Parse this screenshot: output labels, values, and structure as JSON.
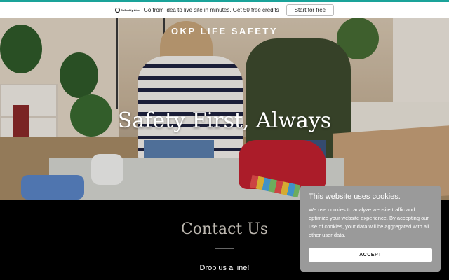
{
  "promo": {
    "brand": "GoDaddy Airo",
    "text": "Go from idea to live site in minutes. Get 50 free credits",
    "button": "Start for free"
  },
  "hero": {
    "site_title": "OKP LIFE SAFETY",
    "heading": "Safety First, Always"
  },
  "contact": {
    "title": "Contact Us",
    "subtitle": "Drop us a line!"
  },
  "cookie_banner": {
    "title": "This website uses cookies.",
    "body": "We use cookies to analyze website traffic and optimize your website experience. By accepting our use of cookies, your data will be aggregated with all other user data.",
    "accept_button": "ACCEPT"
  },
  "colors": {
    "promo_accent": "#1aa39a",
    "cookie_bg": "#9a9a9a",
    "contact_bg": "#000000"
  }
}
